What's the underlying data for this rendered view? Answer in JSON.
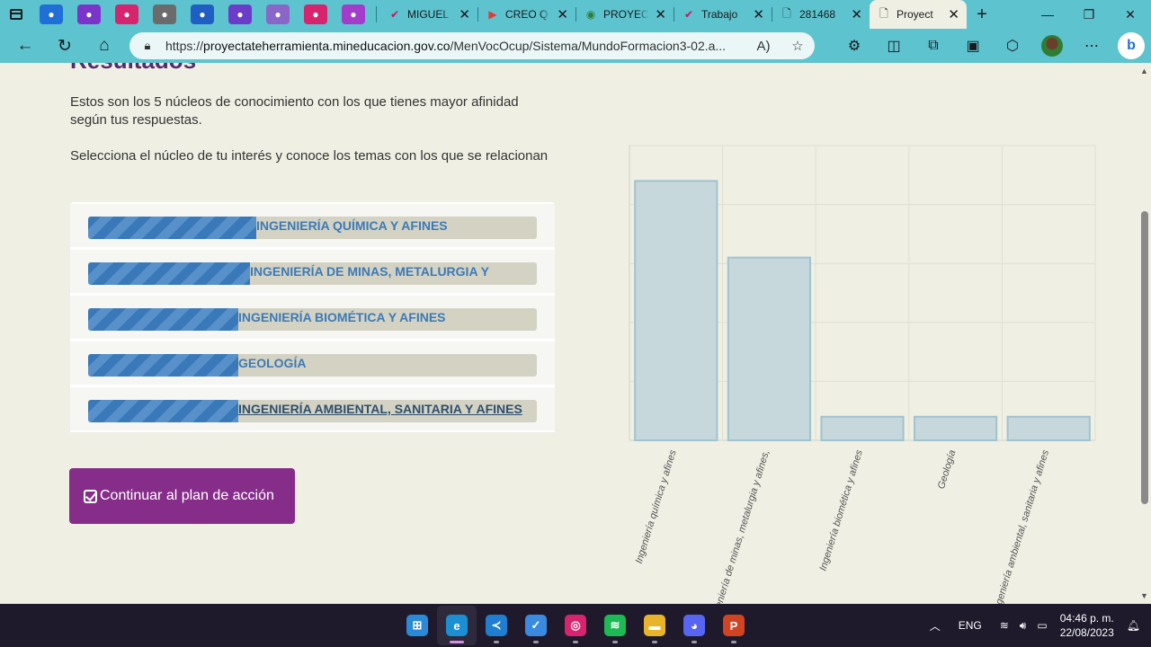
{
  "browser": {
    "pinned_tabs": [
      {
        "icon": "folder-icon",
        "color": "#1f6fd6"
      },
      {
        "icon": "app-icon",
        "color": "#7b34c9"
      },
      {
        "icon": "flag-icon",
        "color": "#d6246e"
      },
      {
        "icon": "camera-icon",
        "color": "#6b6b6b"
      },
      {
        "icon": "gift-icon",
        "color": "#1f5fc4"
      },
      {
        "icon": "laptop-icon",
        "color": "#6a3cc9"
      },
      {
        "icon": "person-icon",
        "color": "#8a66c9"
      },
      {
        "icon": "pen-icon",
        "color": "#d6246e"
      },
      {
        "icon": "plane-icon",
        "color": "#a23cc9"
      }
    ],
    "tabs": [
      {
        "title": "MIGUEL",
        "icon": "check-icon",
        "close": "✕"
      },
      {
        "title": "CREO Q",
        "icon": "youtube-icon",
        "close": "✕"
      },
      {
        "title": "PROYEC",
        "icon": "compass-icon",
        "close": "✕"
      },
      {
        "title": "Trabajo",
        "icon": "check-icon",
        "close": "✕"
      },
      {
        "title": "281468",
        "icon": "document-icon",
        "close": "✕"
      },
      {
        "title": "Proyect",
        "icon": "document-icon",
        "close": "✕",
        "active": true
      }
    ],
    "url_prefix": "https://",
    "url_host": "proyectateherramienta.mineducacion.gov.co",
    "url_path": "/MenVocOcup/Sistema/MundoFormacion3-02.a..."
  },
  "page": {
    "heading": "Resultados",
    "intro": "Estos son los 5 núcleos de conocimiento con los que tienes mayor afinidad según tus respuestas.",
    "instruction": "Selecciona el núcleo de tu interés y conoce los temas con los que se relacionan",
    "nucleos": [
      {
        "label": "INGENIERÍA QUÍMICA Y AFINES",
        "fill": 0.375
      },
      {
        "label": "INGENIERÍA DE MINAS, METALURGIA Y",
        "fill": 0.36
      },
      {
        "label": "INGENIERÍA BIOMÉTICA Y AFINES",
        "fill": 0.335
      },
      {
        "label": "GEOLOGÍA",
        "fill": 0.335
      },
      {
        "label": "INGENIERÍA AMBIENTAL, SANITARIA Y AFINES",
        "fill": 0.335
      }
    ],
    "cta_label": "Continuar al plan de acción"
  },
  "chart_data": {
    "type": "bar",
    "categories": [
      "Ingeniería química y afines",
      "Ingeniería de minas, metalurgia y afines,",
      "Ingeniería biomética y afines",
      "Geología",
      "Ingeniería ambiental, sanitaria y afines"
    ],
    "values": [
      4.4,
      3.1,
      0.4,
      0.4,
      0.4
    ],
    "ylim": [
      0,
      5
    ],
    "grid": true,
    "bar_fill": "#c7d8dc",
    "bar_stroke": "#9fc3cf"
  },
  "taskbar": {
    "apps": [
      {
        "name": "windows-start-icon",
        "color": "#2a8ad8",
        "glyph": "⊞"
      },
      {
        "name": "edge-icon",
        "color": "#1b8fd1",
        "glyph": "e",
        "active": true
      },
      {
        "name": "vscode-icon",
        "color": "#1f7ed0",
        "glyph": "≺"
      },
      {
        "name": "todo-icon",
        "color": "#3a8be0",
        "glyph": "✓"
      },
      {
        "name": "instagram-icon",
        "color": "#d6246e",
        "glyph": "◎"
      },
      {
        "name": "spotify-icon",
        "color": "#1db954",
        "glyph": "≋"
      },
      {
        "name": "file-explorer-icon",
        "color": "#e8b52a",
        "glyph": "▬"
      },
      {
        "name": "discord-icon",
        "color": "#5865f2",
        "glyph": "◕"
      },
      {
        "name": "powerpoint-icon",
        "color": "#d04423",
        "glyph": "P"
      }
    ],
    "language": "ENG",
    "time": "04:46 p. m.",
    "date": "22/08/2023"
  }
}
